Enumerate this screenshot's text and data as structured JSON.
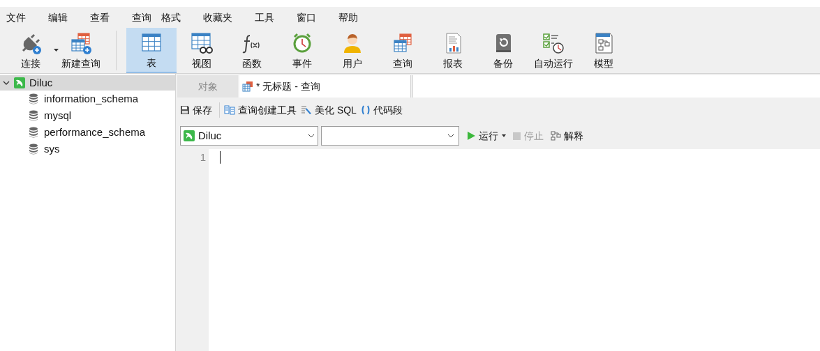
{
  "menu": [
    "文件",
    "编辑",
    "查看",
    "查询",
    "格式",
    "收藏夹",
    "工具",
    "窗口",
    "帮助"
  ],
  "toolbar": [
    {
      "kind": "connect",
      "label": "连接",
      "selected": false,
      "dropdown": true
    },
    {
      "kind": "new-query",
      "label": "新建查询",
      "selected": false,
      "dropdown": false
    },
    {
      "kind": "table",
      "label": "表",
      "selected": true,
      "dropdown": false
    },
    {
      "kind": "view",
      "label": "视图",
      "selected": false,
      "dropdown": false
    },
    {
      "kind": "function",
      "label": "函数",
      "selected": false,
      "dropdown": false
    },
    {
      "kind": "event",
      "label": "事件",
      "selected": false,
      "dropdown": false
    },
    {
      "kind": "user",
      "label": "用户",
      "selected": false,
      "dropdown": false
    },
    {
      "kind": "query",
      "label": "查询",
      "selected": false,
      "dropdown": false
    },
    {
      "kind": "report",
      "label": "报表",
      "selected": false,
      "dropdown": false
    },
    {
      "kind": "backup",
      "label": "备份",
      "selected": false,
      "dropdown": false
    },
    {
      "kind": "schedule",
      "label": "自动运行",
      "selected": false,
      "dropdown": false
    },
    {
      "kind": "model",
      "label": "模型",
      "selected": false,
      "dropdown": false
    }
  ],
  "tree": {
    "label": "Diluc",
    "expanded": true,
    "selected": true,
    "children": [
      {
        "label": "information_schema"
      },
      {
        "label": "mysql"
      },
      {
        "label": "performance_schema"
      },
      {
        "label": "sys"
      }
    ]
  },
  "tabs": [
    {
      "label": "对象",
      "selected": false
    },
    {
      "label": "* 无标题 - 查询",
      "selected": true
    }
  ],
  "editor_toolbar": [
    {
      "kind": "save",
      "label": "保存"
    },
    {
      "kind": "builder",
      "label": "查询创建工具"
    },
    {
      "kind": "beautify",
      "label": "美化 SQL"
    },
    {
      "kind": "snippet",
      "label": "代码段"
    }
  ],
  "connection_select": {
    "value": "Diluc"
  },
  "run": {
    "label": "运行",
    "disabled": false
  },
  "stop": {
    "label": "停止",
    "disabled": true
  },
  "explain": {
    "label": "解释",
    "disabled": false
  },
  "editor": {
    "line_numbers": [
      "1"
    ]
  }
}
